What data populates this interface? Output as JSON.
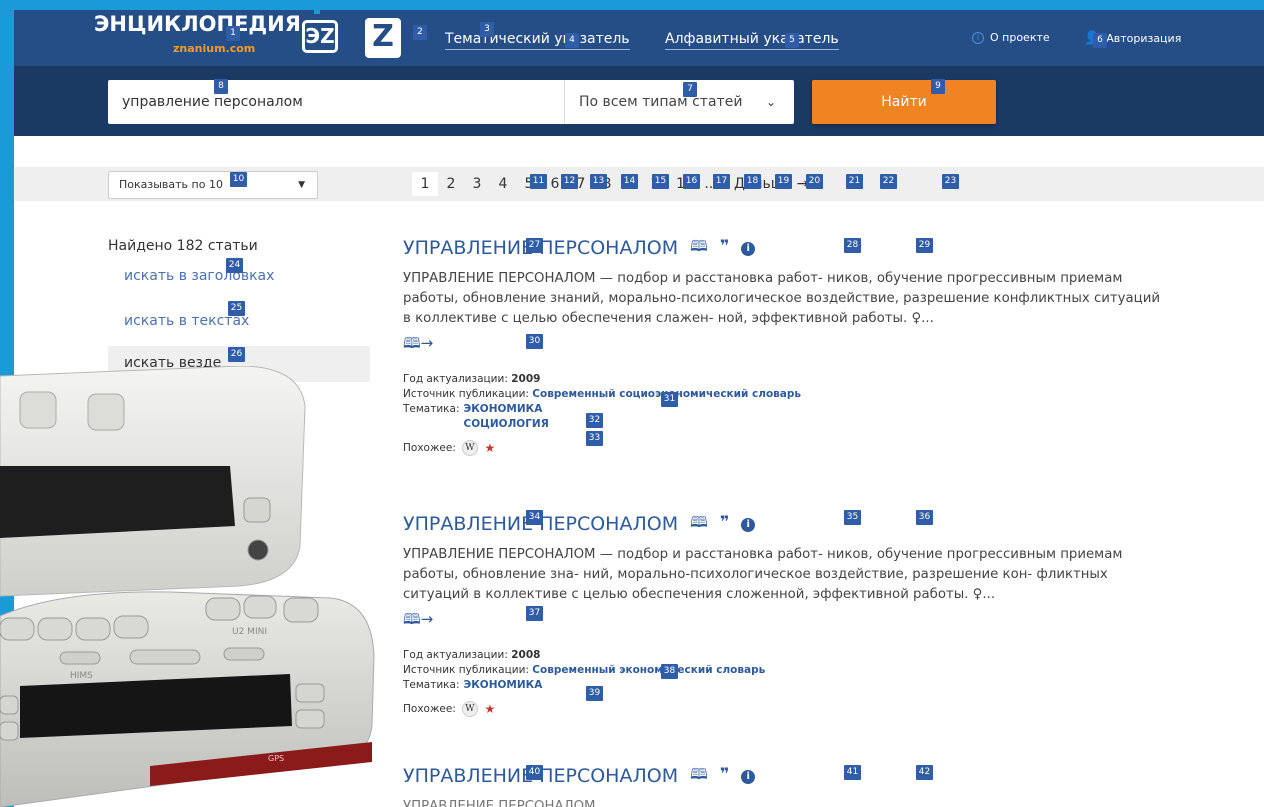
{
  "header": {
    "logo_title": "ЭНЦИКЛОПЕДИЯ",
    "logo_sub": "znanium.com",
    "logo_ez": "ЭZ",
    "logo_z": "Z",
    "nav": [
      {
        "label": "Тематический указатель"
      },
      {
        "label": "Алфавитный указатель"
      }
    ],
    "about_label": "О проекте",
    "auth_label": "Авторизация",
    "accent": "#264e86"
  },
  "search": {
    "query": "управление персоналом",
    "type_selected": "По всем типам статей",
    "submit_label": "Найти",
    "button_color": "#f08422"
  },
  "pager": {
    "per_page": "Показывать по 10",
    "pages": [
      "1",
      "2",
      "3",
      "4",
      "5",
      "6",
      "7",
      "8",
      "9",
      "10",
      "11",
      "..."
    ],
    "current_page": "1",
    "next_label": "Дальше →"
  },
  "sidebar": {
    "found": "Найдено 182 статьи",
    "scopes": [
      {
        "label": "искать в заголовках"
      },
      {
        "label": "искать в текстах"
      },
      {
        "label": "искать везде"
      }
    ]
  },
  "results": [
    {
      "title": "УПРАВЛЕНИЕ ПЕРСОНАЛОМ",
      "text": "УПРАВЛЕНИЕ ПЕРСОНАЛОМ — подбор и расстановка работ- ников, обучение прогрессивным приемам работы, обновление знаний, морально-психологическое воздействие, разрешение конфликтных ситуаций в коллективе с целью обеспечения слажен- ной, эффективной работы. ♀...",
      "year_label": "Год актуализации:",
      "year": "2009",
      "source_label": "Источник публикации:",
      "source": "Современный социоэкономический словарь",
      "topics_label": "Тематика:",
      "topics": [
        "ЭКОНОМИКА",
        "СОЦИОЛОГИЯ"
      ],
      "similar_label": "Похожее:"
    },
    {
      "title": "УПРАВЛЕНИЕ ПЕРСОНАЛОМ",
      "text": "УПРАВЛЕНИЕ ПЕРСОНАЛОМ — подбор и расстановка работ- ников, обучение прогрессивным приемам работы, обновление зна- ний, морально-психологическое воздействие, разрешение кон- фликтных ситуаций в коллективе с целью обеспечения сложенной, эффективной работы. ♀...",
      "year_label": "Год актуализации:",
      "year": "2008",
      "source_label": "Источник публикации:",
      "source": "Современный экономический словарь",
      "topics_label": "Тематика:",
      "topics": [
        "ЭКОНОМИКА"
      ],
      "similar_label": "Похожее:"
    },
    {
      "title": "УПРАВЛЕНИЕ ПЕРСОНАЛОМ",
      "text": "УПРАВЛЕНИЕ ПЕРСОНАЛОМ"
    }
  ],
  "icons": {
    "info": "info-icon",
    "user": "user-icon",
    "read": "read-icon",
    "quote": "quote-icon",
    "wiki": "wikipedia-icon",
    "star": "star-icon"
  },
  "device_labels": {
    "brand": "HIMS",
    "model": "U2 MINI",
    "gps": "GPS"
  },
  "markers": [
    "1",
    "2",
    "3",
    "4",
    "5",
    "6",
    "7",
    "8",
    "9",
    "10",
    "11",
    "12",
    "13",
    "14",
    "15",
    "16",
    "17",
    "18",
    "19",
    "20",
    "21",
    "22",
    "23",
    "24",
    "25",
    "26",
    "27",
    "28",
    "29",
    "30",
    "31",
    "32",
    "33",
    "34",
    "35",
    "36",
    "37",
    "38",
    "39",
    "40",
    "41",
    "42"
  ]
}
